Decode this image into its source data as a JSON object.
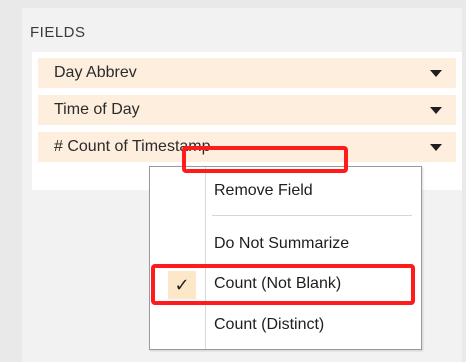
{
  "fields_section": {
    "title": "FIELDS",
    "items": [
      {
        "label": "Day Abbrev"
      },
      {
        "label": "Time of Day"
      },
      {
        "label": "# Count of Timestamp"
      }
    ]
  },
  "context_menu": {
    "items": [
      {
        "label": "Remove Field",
        "checked": false
      },
      {
        "label": "Do Not Summarize",
        "checked": false
      },
      {
        "label": "Count (Not Blank)",
        "checked": true,
        "check_glyph": "✓"
      },
      {
        "label": "Count (Distinct)",
        "checked": false
      }
    ]
  },
  "colors": {
    "field_bg": "#fdeede",
    "highlight_outline": "#ff1b1b",
    "check_bg": "#fde7c9"
  }
}
